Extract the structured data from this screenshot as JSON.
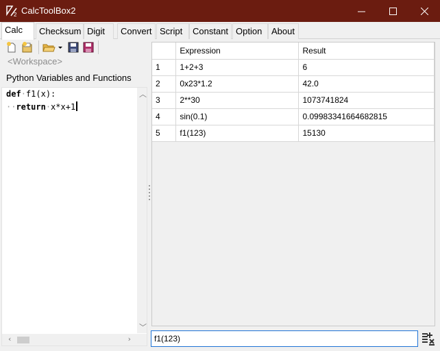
{
  "window": {
    "title": "CalcToolBox2"
  },
  "tabs": [
    "Calc",
    "Checksum",
    "Digit",
    "Convert",
    "Script",
    "Constant",
    "Option",
    "About"
  ],
  "active_tab": "Calc",
  "left": {
    "workspace_placeholder": "<Workspace>",
    "section_title": "Python Variables and Functions",
    "code": {
      "line1": {
        "keyword": "def",
        "rest": "f1(x):"
      },
      "line2": {
        "keyword": "return",
        "rest": "x*x+1"
      }
    }
  },
  "table": {
    "columns": [
      "",
      "Expression",
      "Result"
    ],
    "rows": [
      {
        "index": "1",
        "expression": "1+2+3",
        "result": "6"
      },
      {
        "index": "2",
        "expression": "0x23*1.2",
        "result": "42.0"
      },
      {
        "index": "3",
        "expression": "2**30",
        "result": "1073741824"
      },
      {
        "index": "4",
        "expression": "sin(0.1)",
        "result": "0.09983341664682815"
      },
      {
        "index": "5",
        "expression": "f1(123)",
        "result": "15130"
      }
    ]
  },
  "input": {
    "value": "f1(123)"
  },
  "colors": {
    "titlebar": "#6b1c10",
    "focus_border": "#1e73d6"
  }
}
